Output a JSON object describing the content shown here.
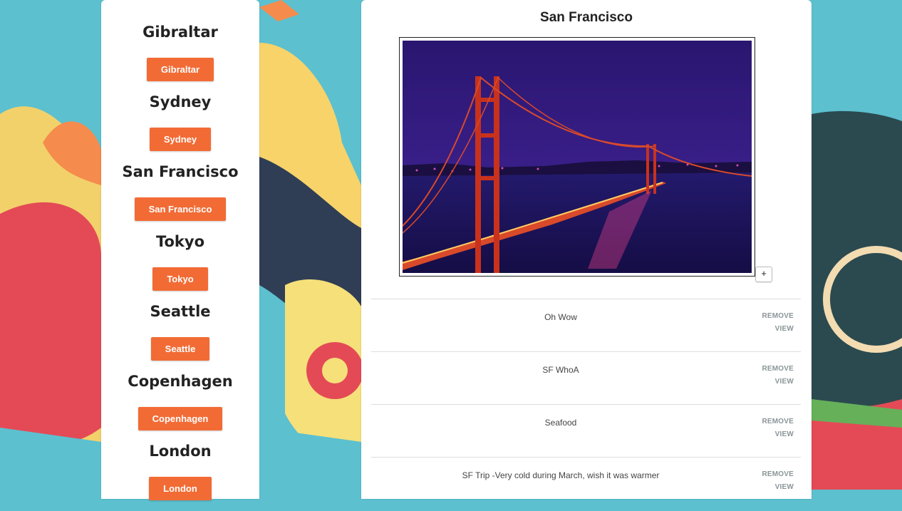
{
  "sidebar": {
    "cities": [
      {
        "name": "Gibraltar",
        "button": "Gibraltar"
      },
      {
        "name": "Sydney",
        "button": "Sydney"
      },
      {
        "name": "San Francisco",
        "button": "San Francisco"
      },
      {
        "name": "Tokyo",
        "button": "Tokyo"
      },
      {
        "name": "Seattle",
        "button": "Seattle"
      },
      {
        "name": "Copenhagen",
        "button": "Copenhagen"
      },
      {
        "name": "London",
        "button": "London"
      }
    ]
  },
  "main": {
    "title": "San Francisco",
    "add_button": "+",
    "entries": [
      {
        "text": "Oh Wow",
        "remove": "REMOVE",
        "view": "VIEW"
      },
      {
        "text": "SF WhoA",
        "remove": "REMOVE",
        "view": "VIEW"
      },
      {
        "text": "Seafood",
        "remove": "REMOVE",
        "view": "VIEW"
      },
      {
        "text": "SF Trip -Very cold during March, wish it was warmer",
        "remove": "REMOVE",
        "view": "VIEW"
      }
    ]
  },
  "colors": {
    "accent": "#f26b35",
    "background": "#5cc0cf",
    "action_text": "#8a9597"
  }
}
